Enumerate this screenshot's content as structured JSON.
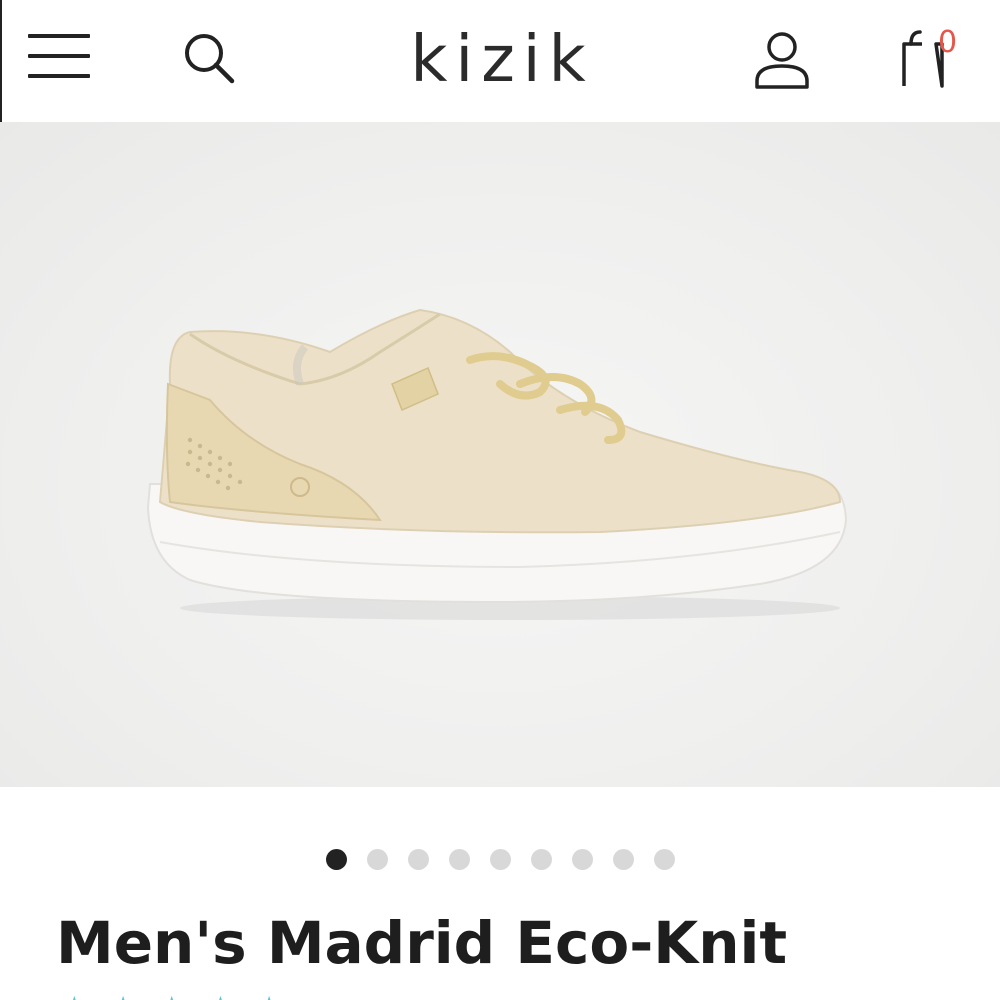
{
  "header": {
    "logo": "kizik",
    "cart_count": "0",
    "icons": [
      "hamburger-menu-icon",
      "search-icon",
      "account-icon",
      "shopping-bag-icon"
    ]
  },
  "product": {
    "title": "Men's Madrid Eco-Knit",
    "image_description": "Beige eco-knit sneaker with white sole",
    "carousel": {
      "total": 9,
      "active_index": 0
    },
    "rating_star_color": "#5ec7cc"
  },
  "colors": {
    "accent": "#e5574d",
    "text": "#1e1e1e",
    "dot_active": "#222222",
    "dot_inactive": "#d8d8d8"
  }
}
